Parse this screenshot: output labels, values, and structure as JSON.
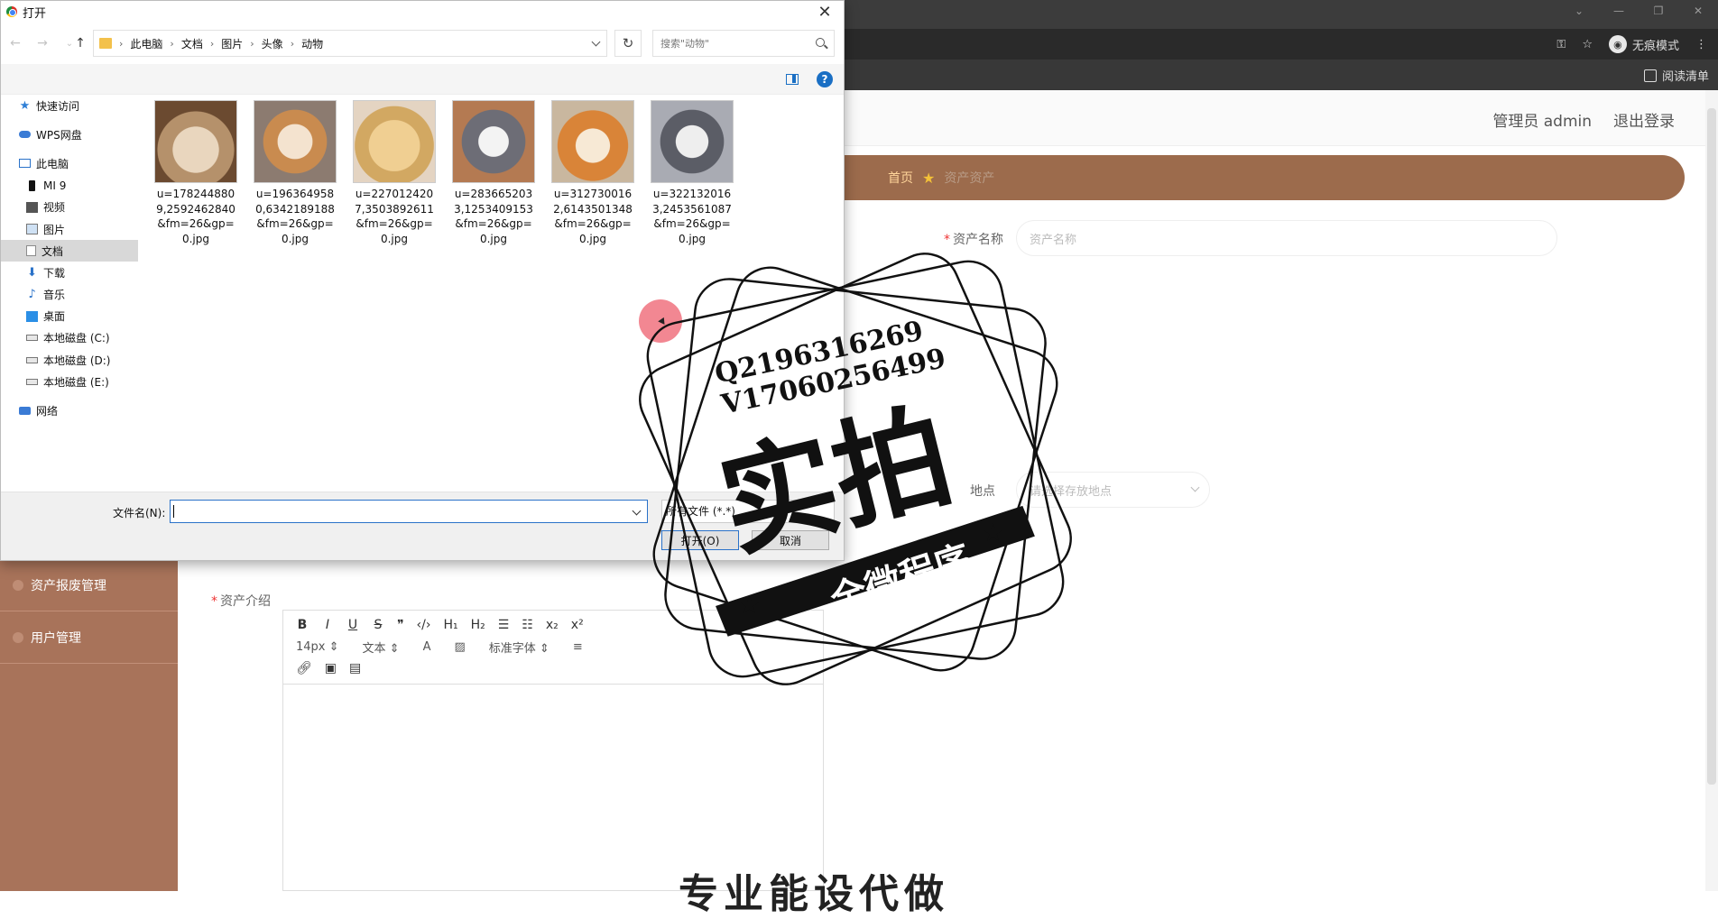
{
  "browser": {
    "incognito_label": "无痕模式",
    "reading_list": "阅读清单"
  },
  "app": {
    "admin_label": "管理员 admin",
    "logout_label": "退出登录",
    "breadcrumb": {
      "home": "首页",
      "current": "资产资产"
    },
    "form": {
      "asset_name_label": "资产名称",
      "asset_name_placeholder": "资产名称",
      "location_label": "地点",
      "location_placeholder": "请选择存放地点",
      "intro_label": "资产介绍"
    },
    "sidebar": [
      {
        "label": "资产报废管理"
      },
      {
        "label": "用户管理"
      }
    ],
    "editor": {
      "font_size": "14px",
      "text_style": "文本",
      "font_family": "标准字体"
    }
  },
  "dialog": {
    "title": "打开",
    "path": [
      "此电脑",
      "文档",
      "图片",
      "头像",
      "动物"
    ],
    "search_placeholder": "搜索\"动物\"",
    "nav_items": [
      {
        "label": "快速访问",
        "icon": "star-icon"
      },
      {
        "label": "WPS网盘",
        "icon": "cloud-icon"
      },
      {
        "label": "此电脑",
        "icon": "computer-icon"
      },
      {
        "label": "MI 9",
        "icon": "phone-icon"
      },
      {
        "label": "视频",
        "icon": "video-icon"
      },
      {
        "label": "图片",
        "icon": "picture-icon"
      },
      {
        "label": "文档",
        "icon": "document-icon",
        "selected": true
      },
      {
        "label": "下载",
        "icon": "download-icon"
      },
      {
        "label": "音乐",
        "icon": "music-icon"
      },
      {
        "label": "桌面",
        "icon": "desktop-icon"
      },
      {
        "label": "本地磁盘 (C:)",
        "icon": "disk-icon"
      },
      {
        "label": "本地磁盘 (D:)",
        "icon": "disk-icon"
      },
      {
        "label": "本地磁盘 (E:)",
        "icon": "disk-icon"
      },
      {
        "label": "网络",
        "icon": "network-icon"
      }
    ],
    "files": [
      {
        "name": "u=1782448809,2592462840&fm=26&gp=0.jpg"
      },
      {
        "name": "u=1963649580,6342189188&fm=26&gp=0.jpg"
      },
      {
        "name": "u=2270124207,3503892611&fm=26&gp=0.jpg"
      },
      {
        "name": "u=2836652033,1253409153&fm=26&gp=0.jpg"
      },
      {
        "name": "u=3127300162,6143501348&fm=26&gp=0.jpg"
      },
      {
        "name": "u=3221320163,2453561087&fm=26&gp=0.jpg"
      }
    ],
    "filename_label": "文件名(N):",
    "filename_value": "",
    "filter_value": "所有文件 (*.*)",
    "open_button": "打开(O)",
    "cancel_button": "取消"
  },
  "watermark": {
    "line1": "Q2196316269",
    "line2": "V17060256499",
    "main": "实拍",
    "ribbon": "全微程序",
    "bottom_text": "专业能设代做"
  }
}
